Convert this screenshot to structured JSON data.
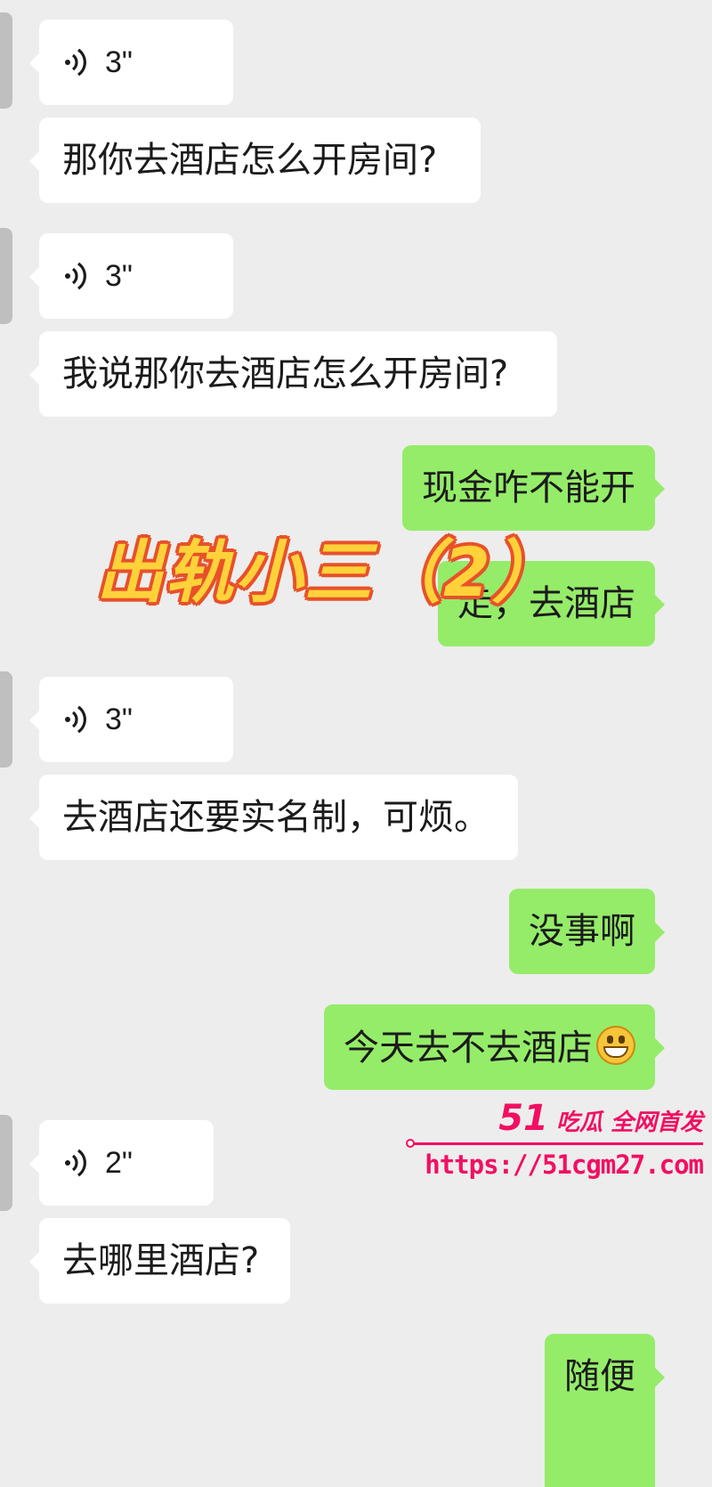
{
  "messages": [
    {
      "dir": "received",
      "type": "voice",
      "duration": "3\""
    },
    {
      "dir": "received",
      "type": "text",
      "text": "那你去酒店怎么开房间?"
    },
    {
      "dir": "received",
      "type": "voice",
      "duration": "3\""
    },
    {
      "dir": "received",
      "type": "text",
      "text": "我说那你去酒店怎么开房间?"
    },
    {
      "dir": "sent",
      "type": "text",
      "text": "现金咋不能开"
    },
    {
      "dir": "sent",
      "type": "text",
      "text": "走，去酒店"
    },
    {
      "dir": "received",
      "type": "voice",
      "duration": "3\""
    },
    {
      "dir": "received",
      "type": "text",
      "text": "去酒店还要实名制，可烦。"
    },
    {
      "dir": "sent",
      "type": "text",
      "text": "没事啊"
    },
    {
      "dir": "sent",
      "type": "text",
      "text": "今天去不去酒店",
      "emoji": "grinning-face"
    },
    {
      "dir": "received",
      "type": "voice",
      "duration": "2\""
    },
    {
      "dir": "received",
      "type": "text",
      "text": "去哪里酒店?"
    },
    {
      "dir": "sent",
      "type": "text",
      "text": "随便"
    }
  ],
  "overlay": {
    "title": "出轨小三（2）"
  },
  "watermark": {
    "brand_num": "51",
    "brand_text": "吃瓜 全网首发",
    "url": "https://51cgm27.com"
  },
  "colors": {
    "sent_bubble": "#95ec69",
    "received_bubble": "#ffffff",
    "background": "#ededed",
    "watermark": "#f20f63",
    "overlay_fill": "#ffd23a",
    "overlay_stroke": "#e8512a"
  }
}
